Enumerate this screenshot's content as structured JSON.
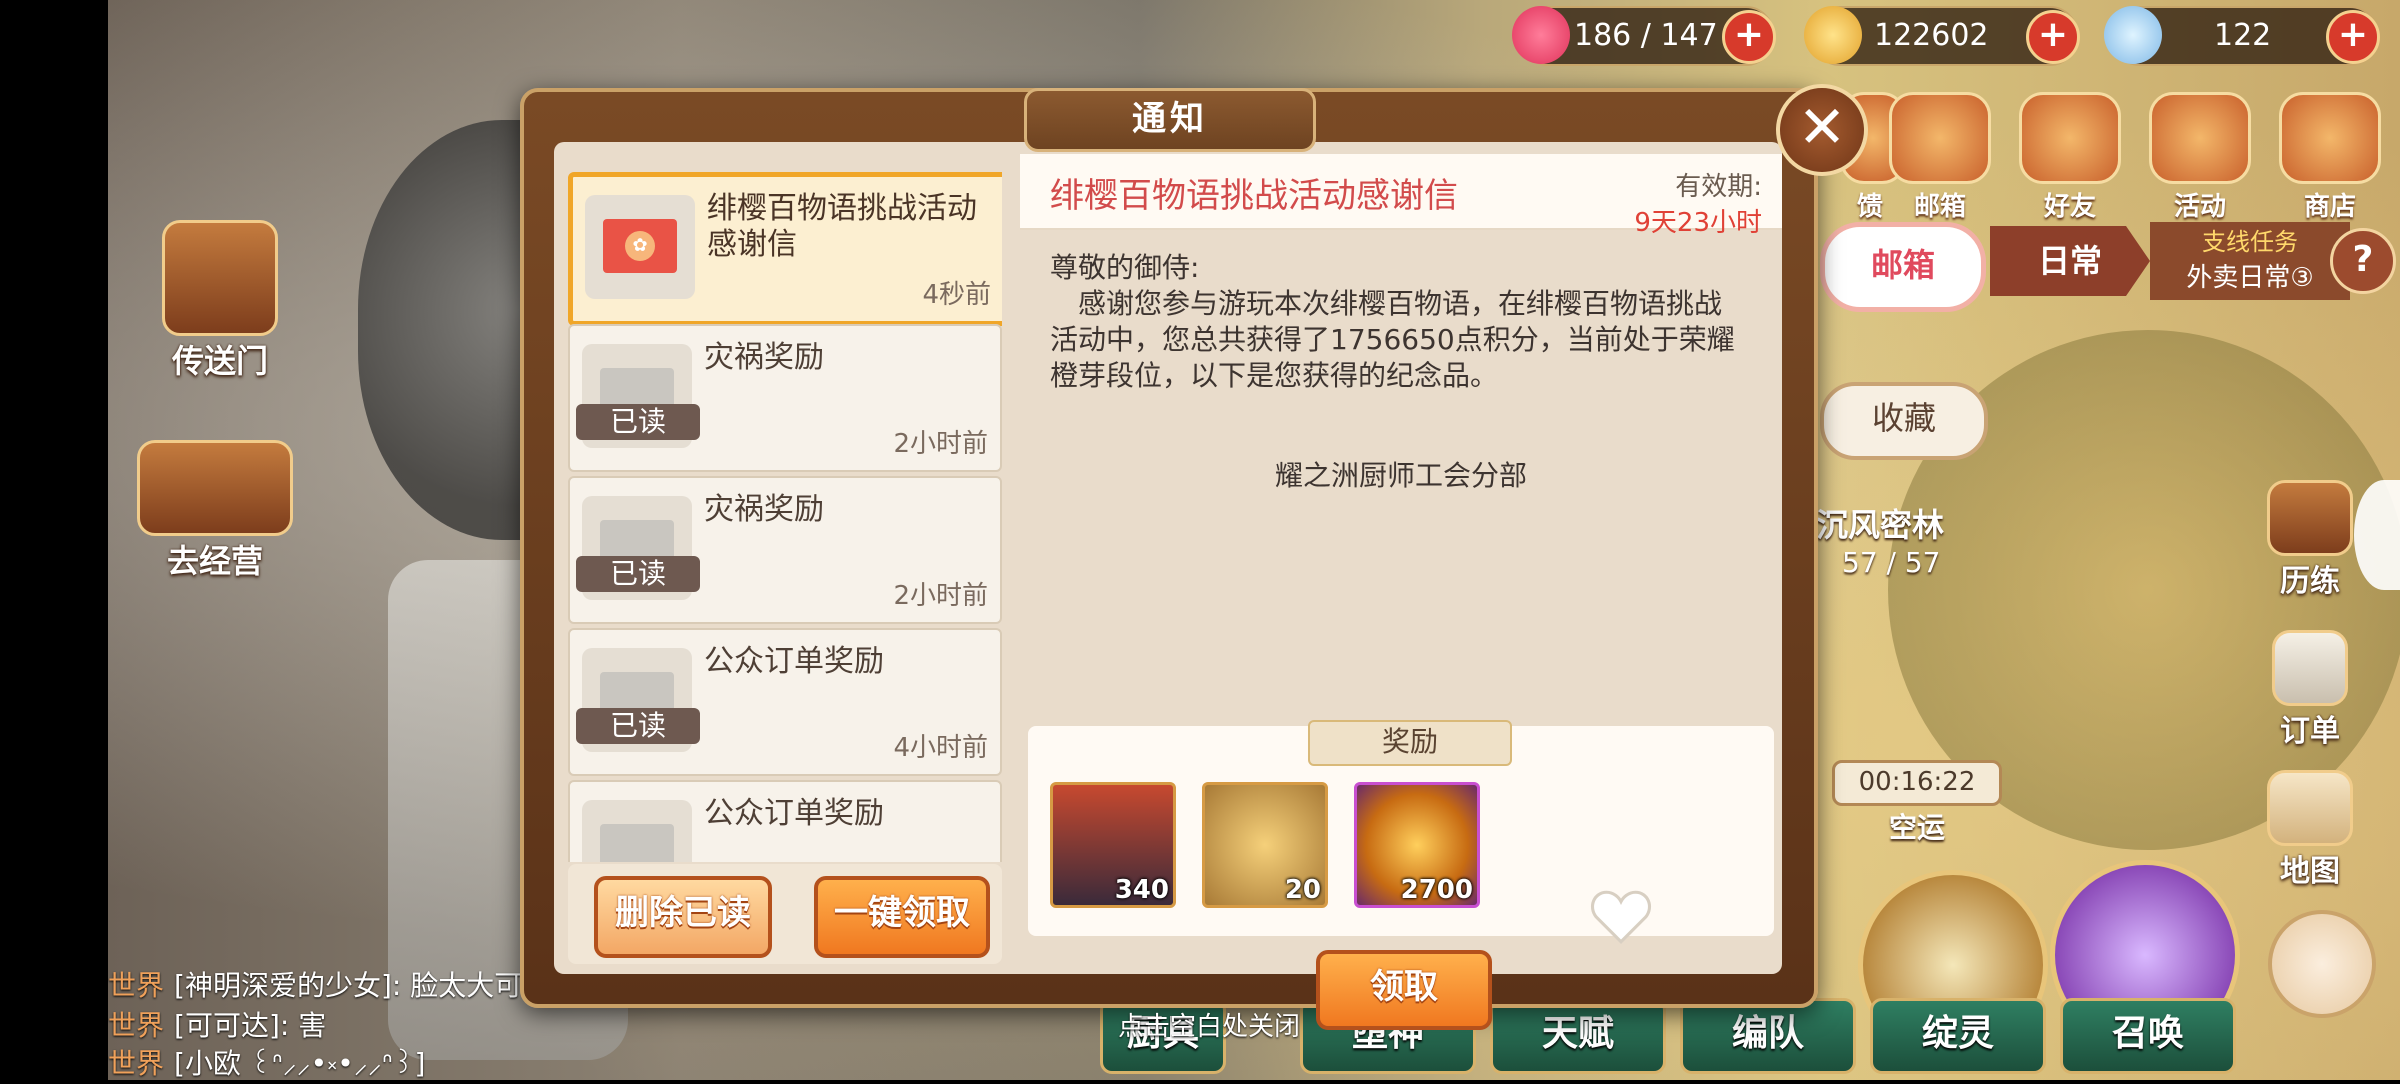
{
  "topbar": {
    "stamina": "186 / 147",
    "gold": "122602",
    "gems": "122"
  },
  "left_side": {
    "portal_label": "传送门",
    "manage_label": "去经营"
  },
  "right_menu": {
    "items": [
      "馈",
      "邮箱",
      "好友",
      "活动",
      "商店"
    ]
  },
  "right_panel": {
    "mailbox_tab": "邮箱",
    "daily_label": "日常",
    "side_quest_label": "支线任务",
    "side_quest_sub": "外卖日常③",
    "collect_tab": "收藏",
    "help_icon_text": "?",
    "location_name": "沉风密林",
    "location_progress": "57 / 57",
    "timer": "00:16:22",
    "timer_label": "空运",
    "trial_label": "历练",
    "order_label": "订单",
    "map_label": "地图"
  },
  "bottom_nav": [
    "堕神",
    "天赋",
    "编队",
    "绽灵",
    "召唤"
  ],
  "bottom_nav_hidden": "厨具",
  "chat": [
    {
      "channel": "世界",
      "text": "[神明深爱的少女]: 脸太大可"
    },
    {
      "channel": "世界",
      "text": "[可可达]: 害"
    },
    {
      "channel": "世界",
      "text": "[小欧 ꒰ᐢ⸝⸝•༝•⸝⸝ᐢ꒱]"
    }
  ],
  "dialog": {
    "title": "通知",
    "close_symbol": "✕",
    "hint": "点击空白处关闭"
  },
  "mail_list": [
    {
      "title": "绯樱百物语挑战活动感谢信",
      "time": "4秒前",
      "read": false,
      "selected": true
    },
    {
      "title": "灾祸奖励",
      "time": "2小时前",
      "read": true
    },
    {
      "title": "灾祸奖励",
      "time": "2小时前",
      "read": true
    },
    {
      "title": "公众订单奖励",
      "time": "4小时前",
      "read": true
    },
    {
      "title": "公众订单奖励",
      "time": "",
      "read": true
    }
  ],
  "read_tag": "已读",
  "list_buttons": {
    "delete_read": "删除已读",
    "claim_all": "一键领取"
  },
  "detail": {
    "heading": "绯樱百物语挑战活动感谢信",
    "valid_label": "有效期:",
    "valid_value": "9天23小时",
    "greeting": "尊敬的御侍:",
    "line1": "　感谢您参与游玩本次绯樱百物语，在绯樱百物语挑战",
    "line2": "活动中，您总共获得了1756650点积分，当前处于荣耀",
    "line3": "橙芽段位，以下是您获得的纪念品。",
    "signature": "耀之洲厨师工会分部",
    "reward_title": "奖励",
    "rewards": [
      {
        "name": "character-fragment",
        "qty": "340"
      },
      {
        "name": "golden-chain",
        "qty": "20"
      },
      {
        "name": "golden-onion",
        "qty": "2700"
      }
    ],
    "claim_button": "领取"
  }
}
